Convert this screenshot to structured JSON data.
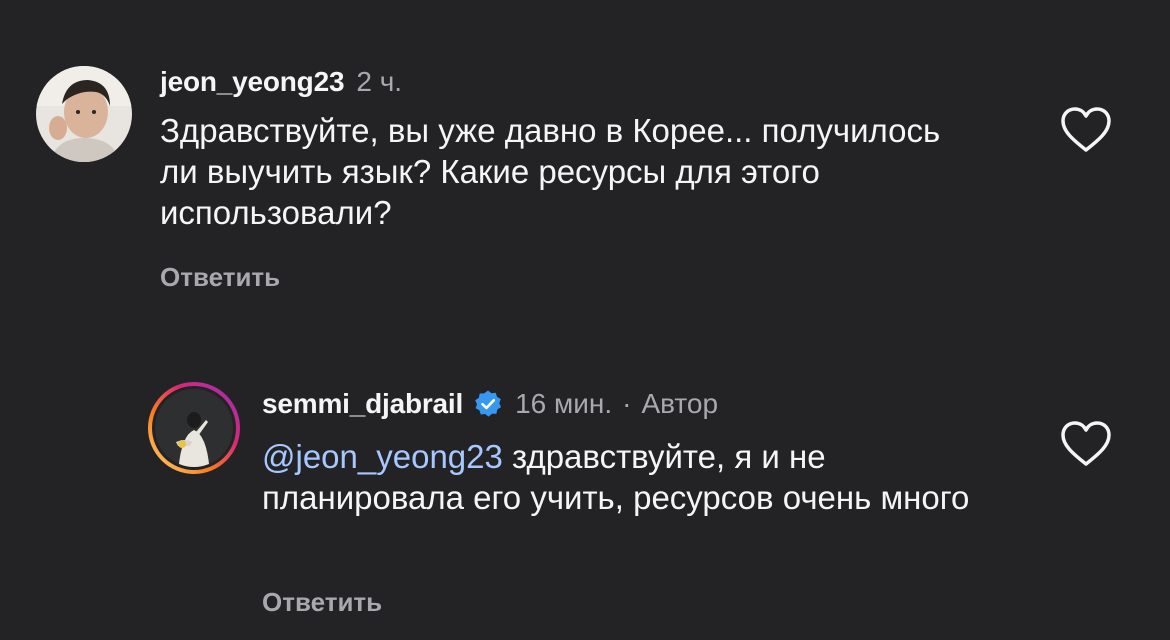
{
  "comments": [
    {
      "username": "jeon_yeong23",
      "time": "2 ч.",
      "text": "Здравствуйте, вы уже давно в Корее... получилось ли выучить язык? Какие ресурсы для этого использовали?",
      "reply_label": "Ответить",
      "icons": {
        "avatar": "user-photo-avatar",
        "like": "heart-outline-icon"
      }
    },
    {
      "username": "semmi_djabrail",
      "time": "16 мин.",
      "separator": "·",
      "author_badge": "Автор",
      "mention": "@jeon_yeong23",
      "text": " здравствуйте, я и не планировала его учить, ресурсов очень много",
      "reply_label": "Ответить",
      "icons": {
        "avatar": "story-ring-avatar",
        "verified": "verified-badge-icon",
        "like": "heart-outline-icon"
      }
    }
  ],
  "colors": {
    "background": "#232326",
    "text_primary": "#f5f5f5",
    "text_secondary": "#a8a8ad",
    "mention": "#a6c8ff",
    "verified": "#3897f0"
  }
}
